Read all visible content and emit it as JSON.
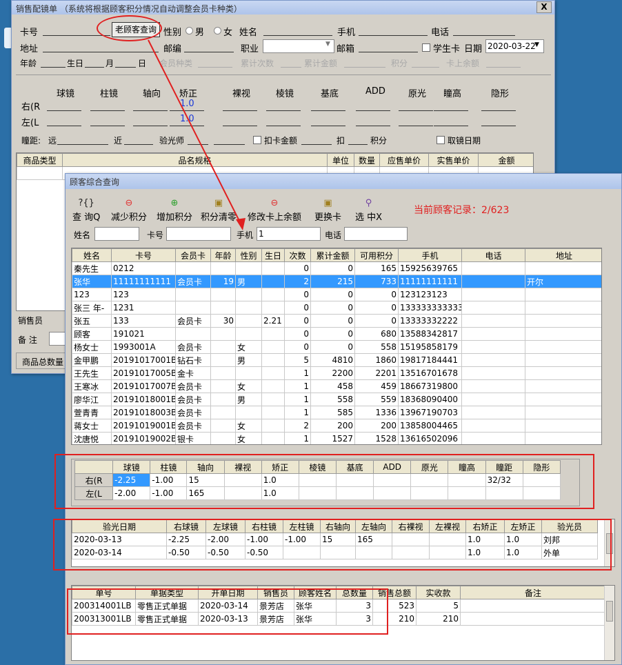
{
  "main_window": {
    "title": "销售配镜单 （系统将根据顾客积分情况自动调整会员卡种类）",
    "close": "X",
    "labels": {
      "card_no": "卡号",
      "old_customer_btn": "老顾客查询",
      "gender": "性别",
      "male": "男",
      "female": "女",
      "name": "姓名",
      "mobile": "手机",
      "phone": "电话",
      "address": "地址",
      "postcode": "邮编",
      "job": "职业",
      "email": "邮箱",
      "student_card": "学生卡",
      "date": "日期",
      "age": "年龄",
      "birthday": "生日",
      "month": "月",
      "day": "日",
      "member_type": "会员种类",
      "total_times": "累计次数",
      "total_amount": "累计金额",
      "points": "积分",
      "card_balance": "卡上余额",
      "pd": "瞳距:",
      "far": "远",
      "near": "近",
      "optometrist": "验光师",
      "deduct_card": "扣卡金额",
      "deduct": "扣",
      "deduct_points": "积分",
      "pickup_date": "取镜日期",
      "right": "右(R",
      "left": "左(L",
      "salesperson": "销售员",
      "remark": "备  注",
      "total_qty": "商品总数量"
    },
    "date_value": "2020-03-22",
    "rx_headers": [
      "球镜",
      "柱镜",
      "轴向",
      "矫正",
      "裸视",
      "棱镜",
      "基底",
      "ADD",
      "原光",
      "瞳高",
      "隐形"
    ],
    "rx_right_correction": "1.0",
    "rx_left_correction": "1.0",
    "goods_headers": [
      "商品类型",
      "品名规格",
      "单位",
      "数量",
      "应售单价",
      "实售单价",
      "金额"
    ]
  },
  "query_window": {
    "title": "顾客综合查询",
    "toolbar": [
      {
        "icon": "?{}",
        "label": "查 询Q"
      },
      {
        "icon": "⊖",
        "label": "减少积分"
      },
      {
        "icon": "⊕",
        "label": "增加积分"
      },
      {
        "icon": "▣",
        "label": "积分清零"
      },
      {
        "icon": "⊖",
        "label": "修改卡上余额"
      },
      {
        "icon": "▣",
        "label": "更换卡"
      },
      {
        "icon": "⚲",
        "label": "选 中X"
      }
    ],
    "record_info": "当前顾客记录：2/623",
    "search": {
      "name": "姓名",
      "card": "卡号",
      "mobile": "手机",
      "mobile_value": "1",
      "phone": "电话"
    },
    "customer_headers": [
      "姓名",
      "卡号",
      "会员卡",
      "年龄",
      "性别",
      "生日",
      "次数",
      "累计金额",
      "可用积分",
      "手机",
      "电话",
      "地址"
    ],
    "customers": [
      [
        "秦先生",
        "0212",
        "",
        "",
        "",
        "",
        "0",
        "0",
        "165",
        "15925639765",
        "",
        ""
      ],
      [
        "张华",
        "11111111111",
        "会员卡",
        "19",
        "男",
        "",
        "2",
        "215",
        "733",
        "11111111111",
        "",
        "开尔"
      ],
      [
        "123",
        "123",
        "",
        "",
        "",
        "",
        "0",
        "0",
        "0",
        "123123123",
        "",
        ""
      ],
      [
        "张三  年-",
        "1231",
        "",
        "",
        "",
        "",
        "0",
        "0",
        "0",
        "133333333333",
        "",
        ""
      ],
      [
        "张五",
        "133",
        "会员卡",
        "30",
        "",
        "2.21",
        "0",
        "0",
        "0",
        "13333332222",
        "",
        ""
      ],
      [
        "顾客",
        "191021",
        "",
        "",
        "",
        "",
        "0",
        "0",
        "680",
        "13588342817",
        "",
        ""
      ],
      [
        "杨女士",
        "1993001A",
        "会员卡",
        "",
        "女",
        "",
        "0",
        "0",
        "558",
        "15195858179",
        "",
        ""
      ],
      [
        "金甲鹏",
        "20191017001B",
        "钻石卡",
        "",
        "男",
        "",
        "5",
        "4810",
        "1860",
        "19817184441",
        "",
        ""
      ],
      [
        "王先生",
        "20191017005B",
        "金卡",
        "",
        "",
        "",
        "1",
        "2200",
        "2201",
        "13516701678",
        "",
        ""
      ],
      [
        "王寒冰",
        "20191017007B",
        "会员卡",
        "",
        "女",
        "",
        "1",
        "458",
        "459",
        "18667319800",
        "",
        ""
      ],
      [
        "廖华江",
        "20191018001B",
        "会员卡",
        "",
        "男",
        "",
        "1",
        "558",
        "559",
        "18368090400",
        "",
        ""
      ],
      [
        "萱青青",
        "20191018003B",
        "会员卡",
        "",
        "",
        "",
        "1",
        "585",
        "1336",
        "13967190703",
        "",
        ""
      ],
      [
        "蒋女士",
        "20191019001B",
        "会员卡",
        "",
        "女",
        "",
        "2",
        "200",
        "200",
        "13858004465",
        "",
        ""
      ],
      [
        "沈唐悦",
        "20191019002B",
        "银卡",
        "",
        "女",
        "",
        "1",
        "1527",
        "1528",
        "13616502096",
        "",
        ""
      ]
    ],
    "rx_headers": [
      "球镜",
      "柱镜",
      "轴向",
      "裸视",
      "矫正",
      "棱镜",
      "基底",
      "ADD",
      "原光",
      "瞳高",
      "瞳距",
      "隐形"
    ],
    "rx_rows": [
      {
        "eye": "右(R",
        "values": [
          "-2.25",
          "-1.00",
          "15",
          "",
          "1.0",
          "",
          "",
          "",
          "",
          "",
          "32/32",
          ""
        ]
      },
      {
        "eye": "左(L",
        "values": [
          "-2.00",
          "-1.00",
          "165",
          "",
          "1.0",
          "",
          "",
          "",
          "",
          "",
          "",
          ""
        ]
      }
    ],
    "exam_headers": [
      "验光日期",
      "右球镜",
      "左球镜",
      "右柱镜",
      "左柱镜",
      "右轴向",
      "左轴向",
      "右裸视",
      "左裸视",
      "右矫正",
      "左矫正",
      "验光员"
    ],
    "exams": [
      [
        "2020-03-13",
        "-2.25",
        "-2.00",
        "-1.00",
        "-1.00",
        "15",
        "165",
        "",
        "",
        "1.0",
        "1.0",
        "刘邦"
      ],
      [
        "2020-03-14",
        "-0.50",
        "-0.50",
        "-0.50",
        "",
        "",
        "",
        "",
        "",
        "1.0",
        "1.0",
        "外单"
      ]
    ],
    "order_headers": [
      "单号",
      "单据类型",
      "开单日期",
      "销售员",
      "顾客姓名",
      "总数量",
      "销售总额",
      "实收款",
      "备注"
    ],
    "orders": [
      [
        "200314001LB",
        "零售正式单据",
        "2020-03-14",
        "景芳店",
        "张华",
        "3",
        "523",
        "5",
        ""
      ],
      [
        "200313001LB",
        "零售正式单据",
        "2020-03-13",
        "景芳店",
        "张华",
        "3",
        "210",
        "210",
        ""
      ]
    ]
  }
}
